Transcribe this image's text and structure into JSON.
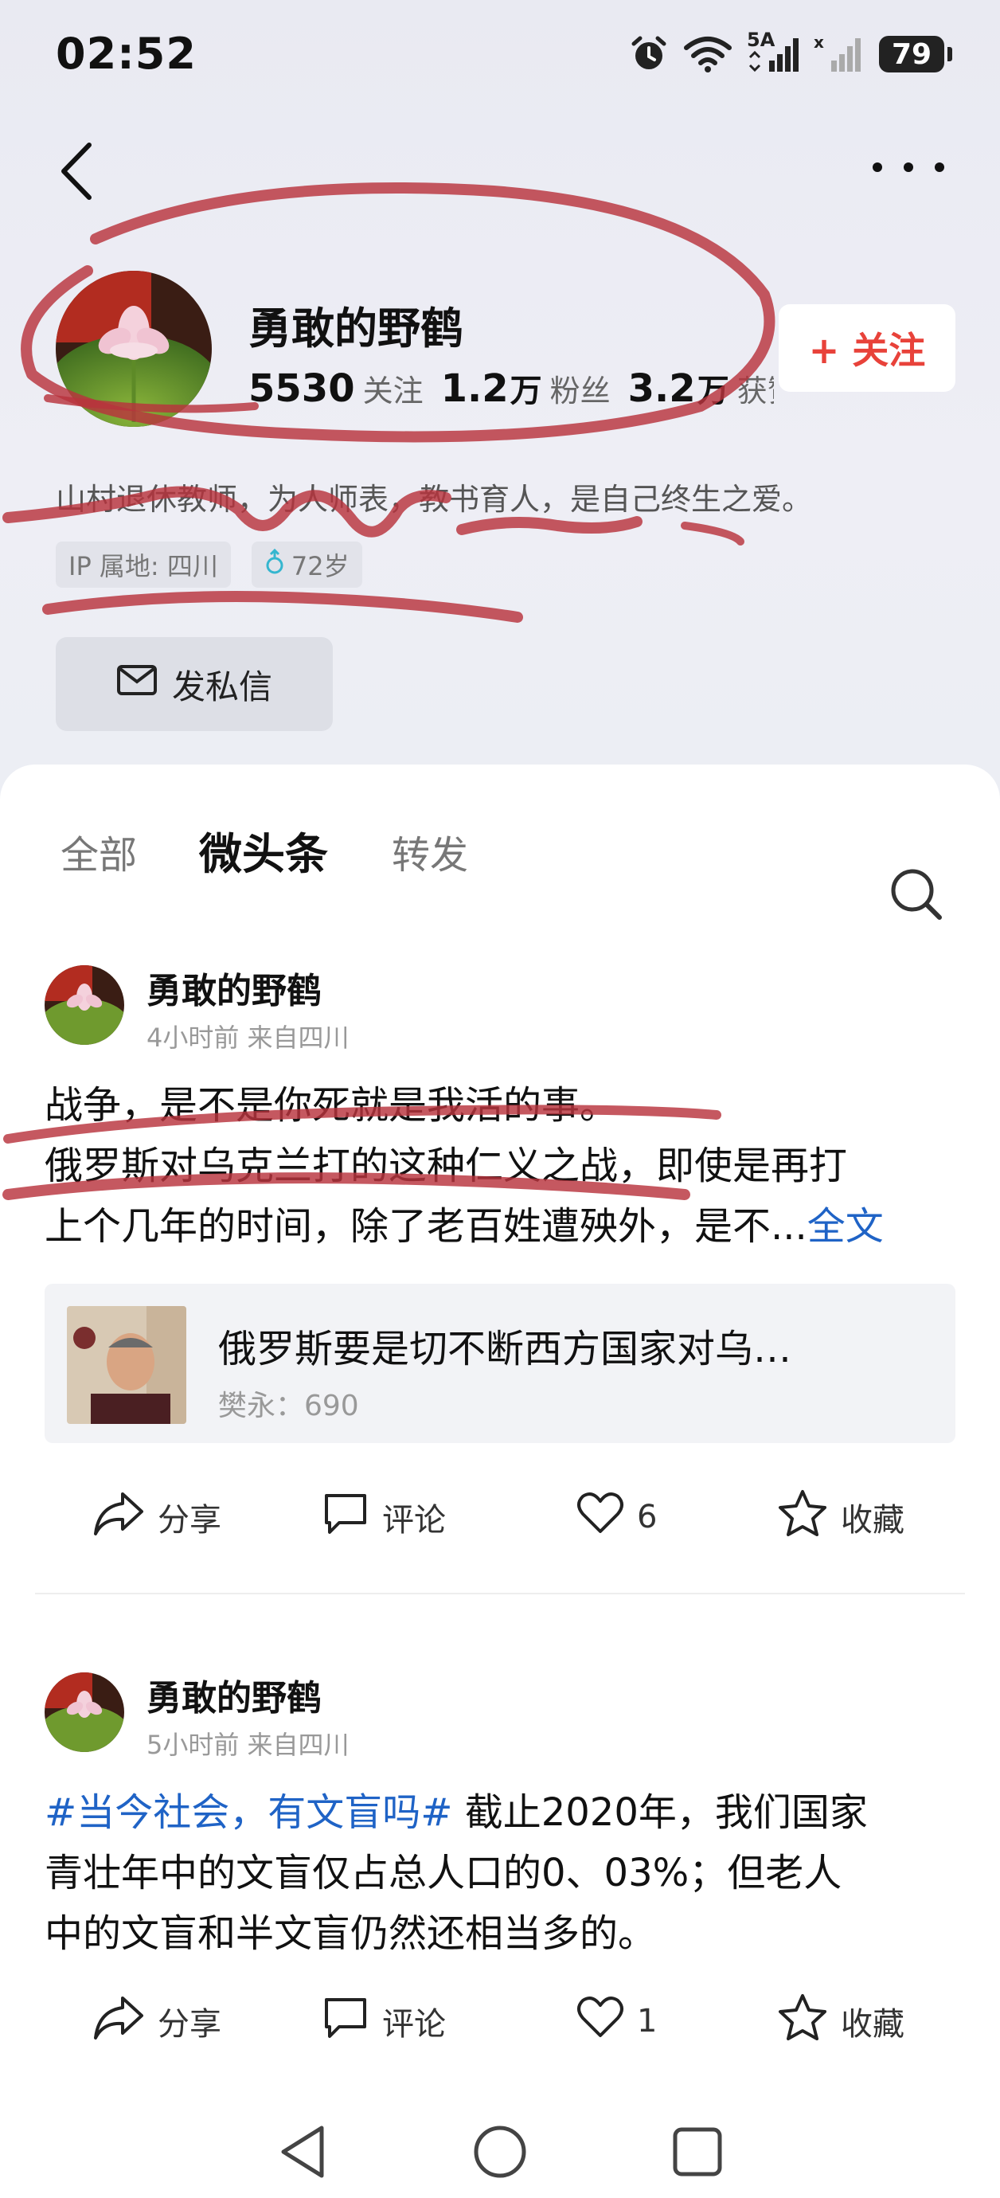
{
  "status_bar": {
    "time": "02:52",
    "network_label": "5A",
    "battery": "79",
    "icons": [
      "alarm-icon",
      "wifi-icon",
      "signal-icon",
      "signal-empty-icon",
      "battery-icon"
    ]
  },
  "header": {
    "back_icon": "back-arrow-icon",
    "more_icon": "more-dots-icon"
  },
  "profile": {
    "name": "勇敢的野鹤",
    "stats": [
      {
        "num": "5530",
        "unit": "",
        "label": "关注"
      },
      {
        "num": "1.2",
        "unit": "万",
        "label": "粉丝"
      },
      {
        "num": "3.2",
        "unit": "万",
        "label": "获赞"
      }
    ],
    "follow_label": "+ 关注",
    "bio": "山村退休教师，为人师表，教书育人，是自己终生之爱。",
    "tags": {
      "ip": "IP 属地: 四川",
      "age": "72岁"
    },
    "message_label": "发私信"
  },
  "tabs": [
    {
      "label": "全部",
      "active": false
    },
    {
      "label": "微头条",
      "active": true
    },
    {
      "label": "转发",
      "active": false
    }
  ],
  "posts": [
    {
      "author": "勇敢的野鹤",
      "meta": "4小时前 来自四川",
      "lines": [
        "战争，是不是你死就是我活的事。",
        "俄罗斯对乌克兰打的这种仁义之战，即使是再打",
        "上个几年的时间，除了老百姓遭殃外，是不..."
      ],
      "more": "全文",
      "quote": {
        "title": "俄罗斯要是切不断西方国家对乌…",
        "meta": "樊永：690"
      },
      "actions": {
        "share": "分享",
        "comment": "评论",
        "like": "6",
        "collect": "收藏"
      }
    },
    {
      "author": "勇敢的野鹤",
      "meta": "5小时前 来自四川",
      "hashtag": "#当今社会，有文盲吗#",
      "text_rest": " 截止2020年，我们国家",
      "lines": [
        "青壮年中的文盲仅占总人口的0、03%；但老人",
        "中的文盲和半文盲仍然还相当多的。"
      ],
      "actions": {
        "share": "分享",
        "comment": "评论",
        "like": "1",
        "collect": "收藏"
      }
    }
  ],
  "colors": {
    "accent_red": "#e8423a",
    "link_blue": "#1f63c6",
    "scribble": "#b8333d"
  }
}
